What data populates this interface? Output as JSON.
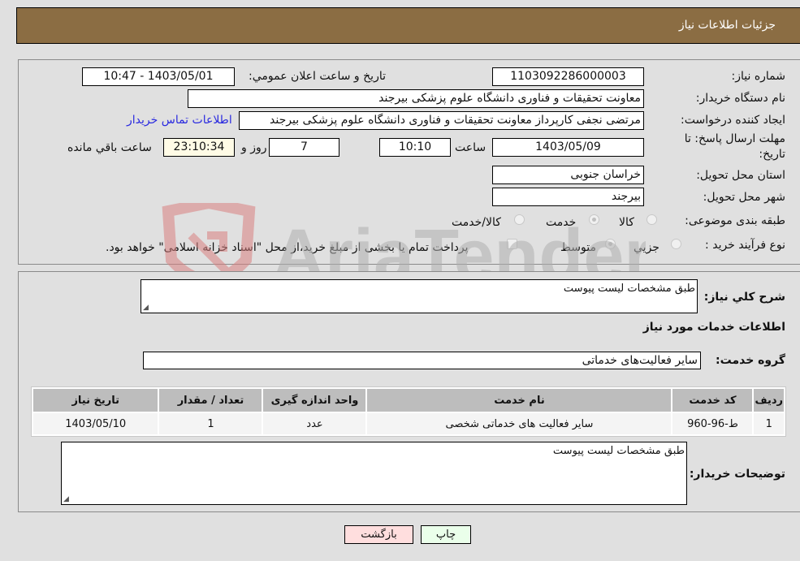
{
  "header": {
    "title": "جزئيات اطلاعات نياز"
  },
  "fields": {
    "need_number": {
      "label": "شماره نياز:",
      "value": "1103092286000003"
    },
    "announce_datetime": {
      "label": "تاريخ و ساعت اعلان عمومي:",
      "value": "1403/05/01 - 10:47"
    },
    "buyer_org": {
      "label": "نام دستگاه خريدار:",
      "value": "معاونت تحقيقات و فناوری دانشگاه علوم پزشکی بيرجند"
    },
    "requester": {
      "label": "ايجاد کننده درخواست:",
      "value": "مرتضی نجفی کارپرداز معاونت تحقيقات و فناوری دانشگاه علوم پزشکی بيرجند"
    },
    "buyer_contact_link": "اطلاعات تماس خريدار",
    "deadline": {
      "label_line1": "مهلت ارسال پاسخ: تا",
      "label_line2": "تاريخ:",
      "date": "1403/05/09",
      "time_label": "ساعت",
      "time": "10:10",
      "days": "7",
      "days_label": "روز و",
      "remaining": "23:10:34",
      "remaining_label": "ساعت باقي مانده"
    },
    "province": {
      "label": "استان محل تحويل:",
      "value": "خراسان جنوبی"
    },
    "city": {
      "label": "شهر محل تحويل:",
      "value": "بيرجند"
    },
    "category": {
      "label": "طبقه بندی موضوعی:",
      "options": [
        "کالا",
        "خدمت",
        "کالا/خدمت"
      ],
      "selected": "خدمت"
    },
    "purchase_type": {
      "label": "نوع فرآيند خريد :",
      "options": [
        "جزيي",
        "متوسط"
      ],
      "selected": "متوسط",
      "treasury_note": "پرداخت تمام يا بخشی از مبلغ خريد،از محل \"اسناد خزانه اسلامی\" خواهد بود."
    }
  },
  "description": {
    "label": "شرح کلي نياز:",
    "value": "طبق مشخصات ليست پيوست"
  },
  "services_section_title": "اطلاعات خدمات مورد نياز",
  "service_group": {
    "label": "گروه خدمت:",
    "value": "ساير فعاليت‌های خدماتی"
  },
  "table": {
    "headers": [
      "رديف",
      "کد خدمت",
      "نام خدمت",
      "واحد اندازه گيری",
      "تعداد / مقدار",
      "تاريخ نياز"
    ],
    "rows": [
      [
        "1",
        "ط-96-960",
        "ساير فعاليت های خدماتی شخصی",
        "عدد",
        "1",
        "1403/05/10"
      ]
    ]
  },
  "buyer_notes": {
    "label": "توضيحات خريدار:",
    "value": "طبق مشخصات ليست پيوست"
  },
  "buttons": {
    "print": "چاپ",
    "back": "بازگشت"
  },
  "watermark": "AriaTender.neT",
  "colors": {
    "header_bg": "#8b6d43",
    "link": "#2a2ae0",
    "print_btn": "#eaffea",
    "back_btn": "#ffdede"
  }
}
